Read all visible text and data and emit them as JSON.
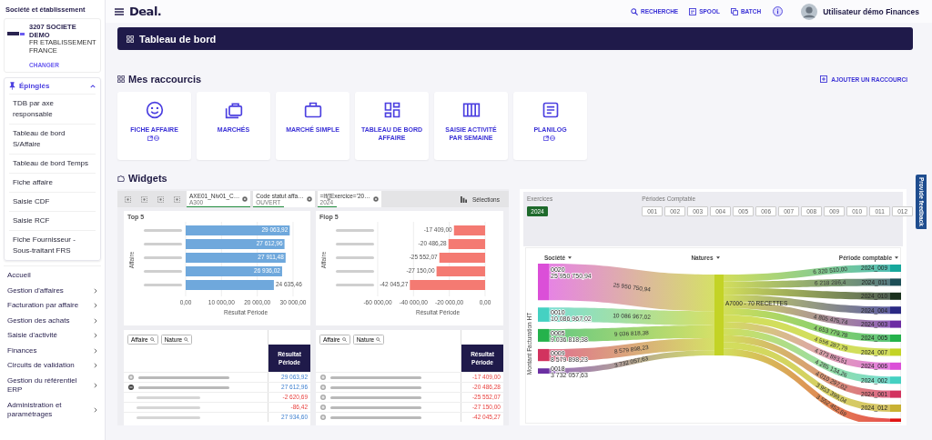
{
  "sidebar": {
    "section_title": "Société et établissement",
    "company": {
      "name": "3207 SOCIETE DEMO",
      "establishment": "FR ETABLISSEMENT FRANCE",
      "action": "CHANGER"
    },
    "pinned": {
      "title": "Épinglés",
      "expanded": true,
      "items": [
        {
          "label": "TDB par axe responsable"
        },
        {
          "label": "Tableau de bord S/Affaire"
        },
        {
          "label": "Tableau de bord Temps"
        },
        {
          "label": "Fiche affaire"
        },
        {
          "label": "Saisie CDF"
        },
        {
          "label": "Saisie RCF"
        },
        {
          "label": "Fiche Fournisseur - Sous-traitant FRS"
        }
      ]
    },
    "menu": [
      {
        "label": "Accueil",
        "expandable": false
      },
      {
        "label": "Gestion d'affaires",
        "expandable": true
      },
      {
        "label": "Facturation par affaire",
        "expandable": true
      },
      {
        "label": "Gestion des achats",
        "expandable": true
      },
      {
        "label": "Saisie d'activité",
        "expandable": true
      },
      {
        "label": "Finances",
        "expandable": true
      },
      {
        "label": "Circuits de validation",
        "expandable": true
      },
      {
        "label": "Gestion du référentiel ERP",
        "expandable": true
      },
      {
        "label": "Administration et paramétrages",
        "expandable": true
      }
    ]
  },
  "header": {
    "logo": "Deal.",
    "actions": [
      {
        "kind": "search",
        "label": "RECHERCHE"
      },
      {
        "kind": "spool",
        "label": "SPOOL"
      },
      {
        "kind": "batch",
        "label": "BATCH"
      },
      {
        "kind": "info"
      }
    ],
    "user": "Utilisateur démo Finances"
  },
  "page_title": "Tableau de bord",
  "shortcuts": {
    "title": "Mes raccourcis",
    "add_label": "AJOUTER UN RACCOURCI",
    "items": [
      {
        "kind": "smiley",
        "label": "FICHE AFFAIRE",
        "external": true
      },
      {
        "kind": "briefcases",
        "label": "MARCHÉS",
        "external": false
      },
      {
        "kind": "briefcase",
        "label": "MARCHÉ SIMPLE",
        "external": false
      },
      {
        "kind": "dashboard",
        "label": "TABLEAU DE BORD AFFAIRE",
        "external": false
      },
      {
        "kind": "columns",
        "label": "SAISIE ACTIVITÉ PAR SEMAINE",
        "external": false
      },
      {
        "kind": "document",
        "label": "PLANILOG",
        "external": true
      }
    ]
  },
  "widgets_title": "Widgets",
  "widget_left": {
    "filters": [
      {
        "label": "AXE01_Niv01_C…",
        "value": "A300",
        "level": 1
      },
      {
        "label": "Code statut affa…",
        "value": "OUVERT",
        "level": 0.5
      },
      {
        "label": "=If([Exercice='20…",
        "value": "2024",
        "level": 0.3
      }
    ],
    "selections_label": "Sélections",
    "charts": [
      {
        "title": "Top 5",
        "chart_data": {
          "type": "bar",
          "orientation": "horizontal",
          "ylabel": "Affaire",
          "xlabel": "Résultat Période",
          "grid": true,
          "xlim": [
            0,
            30000
          ],
          "xticks": [
            {
              "value": 0,
              "label": "0,00"
            },
            {
              "value": 10000,
              "label": "10 000,00"
            },
            {
              "value": 20000,
              "label": "20 000,00"
            },
            {
              "value": 30000,
              "label": "30 000,00"
            }
          ],
          "series": [
            {
              "color": "#6fa8dc",
              "values": [
                29064,
                27613,
                27911,
                26936,
                24635
              ]
            }
          ],
          "value_labels": [
            "29 063,92",
            "27 612,96",
            "27 911,48",
            "26 936,02",
            "24 635,46"
          ]
        }
      },
      {
        "title": "Flop 5",
        "chart_data": {
          "type": "bar",
          "orientation": "horizontal",
          "ylabel": "Affaire",
          "xlabel": "Résultat Période",
          "grid": true,
          "xlim": [
            -60000,
            0
          ],
          "xticks": [
            {
              "value": -60000,
              "label": "-60 000,00"
            },
            {
              "value": -40000,
              "label": "-40 000,00"
            },
            {
              "value": -20000,
              "label": "-20 000,00"
            },
            {
              "value": 0,
              "label": "0,00"
            }
          ],
          "series": [
            {
              "color": "#f47a72",
              "values": [
                -17409,
                -20486,
                -25552,
                -27150,
                -42045
              ]
            }
          ],
          "value_labels": [
            "-17 409,00",
            "-20 486,28",
            "-25 552,07",
            "-27 150,00",
            "-42 045,27"
          ]
        }
      }
    ],
    "tables": [
      {
        "filters": [
          "Affaire",
          "Nature"
        ],
        "column": "Résultat Période",
        "rows": [
          {
            "value": "29 063,92",
            "negative": false,
            "expanded": false
          },
          {
            "value": "27 612,96",
            "negative": false,
            "expanded": true,
            "children": [
              {
                "value": "-2 620,69",
                "negative": true
              },
              {
                "value": "-86,42",
                "negative": true
              },
              {
                "value": "27 934,60",
                "negative": false
              }
            ]
          }
        ]
      },
      {
        "filters": [
          "Affaire",
          "Nature"
        ],
        "column": "Résultat Période",
        "rows": [
          {
            "value": "-17 409,00",
            "negative": true,
            "expanded": false
          },
          {
            "value": "-20 486,28",
            "negative": true,
            "expanded": false
          },
          {
            "value": "-25 552,07",
            "negative": true,
            "expanded": false
          },
          {
            "value": "-27 150,00",
            "negative": true,
            "expanded": false
          },
          {
            "value": "-42 045,27",
            "negative": true,
            "expanded": false
          }
        ]
      }
    ]
  },
  "widget_right": {
    "exercises_label": "Exercices",
    "exercises": [
      {
        "label": "2024",
        "selected": true
      }
    ],
    "periods_label": "Périodes Comptable",
    "periods": [
      {
        "label": "001",
        "selected": false
      },
      {
        "label": "002",
        "selected": false
      },
      {
        "label": "003",
        "selected": false
      },
      {
        "label": "004",
        "selected": false
      },
      {
        "label": "005",
        "selected": false
      },
      {
        "label": "006",
        "selected": false
      },
      {
        "label": "007",
        "selected": false
      },
      {
        "label": "008",
        "selected": false
      },
      {
        "label": "009",
        "selected": false
      },
      {
        "label": "010",
        "selected": false
      },
      {
        "label": "011",
        "selected": false
      },
      {
        "label": "012",
        "selected": false
      }
    ],
    "sankey": {
      "columns": [
        "Société",
        "Natures",
        "Période comptable"
      ],
      "axis_label": "Montant Facturation HT",
      "sources": [
        {
          "label": "0020",
          "value": "25 950 750,94",
          "flow_label": "25 950 750,94",
          "color": "#db4fd8"
        },
        {
          "label": "0010",
          "value": "10 086 967,02",
          "flow_label": "10 086 967,02",
          "color": "#45d1c2"
        },
        {
          "label": "0005",
          "value": "9 036 818,38",
          "flow_label": "9 036 818,38",
          "color": "#25b24c"
        },
        {
          "label": "0009",
          "value": "8 579 898,23",
          "flow_label": "8 579 898,23",
          "color": "#d2335f"
        },
        {
          "label": "0018",
          "value": "3 732 057,63",
          "flow_label": "3 732 057,63",
          "color": "#6b2fa2"
        }
      ],
      "nature": {
        "label": "A7000 - 70 RECETTES",
        "color": "#c3d326"
      },
      "targets": [
        {
          "label": "2024_009",
          "color": "#17a89c",
          "flow_label": "6 320 510,00"
        },
        {
          "label": "2024_011",
          "color": "#1d4f57",
          "flow_label": "6 218 286,4"
        },
        {
          "label": "2024_010",
          "color": "#1a301d"
        },
        {
          "label": "2024_004",
          "color": "#2b2a84"
        },
        {
          "label": "2024_003",
          "color": "#6c2ba3",
          "flow_label": "4 805 475,74"
        },
        {
          "label": "2024_005",
          "color": "#25b24c",
          "flow_label": "4 653 779,78"
        },
        {
          "label": "2024_007",
          "color": "#c3d326",
          "flow_label": "4 556 287,79"
        },
        {
          "label": "2024_006",
          "color": "#db4fd8",
          "flow_label": "4 373 893,51"
        },
        {
          "label": "2024_002",
          "color": "#45d1c2",
          "flow_label": "4 285 134,26"
        },
        {
          "label": "2024_001",
          "color": "#d2335f",
          "flow_label": "4 010 297,02"
        },
        {
          "label": "2024_012",
          "color": "#c9b133",
          "flow_label": "3 953 399,04"
        },
        {
          "color": "#e01414",
          "flow_label": "3 552 452,69"
        }
      ]
    }
  },
  "feedback_tab": "Provide feedback"
}
